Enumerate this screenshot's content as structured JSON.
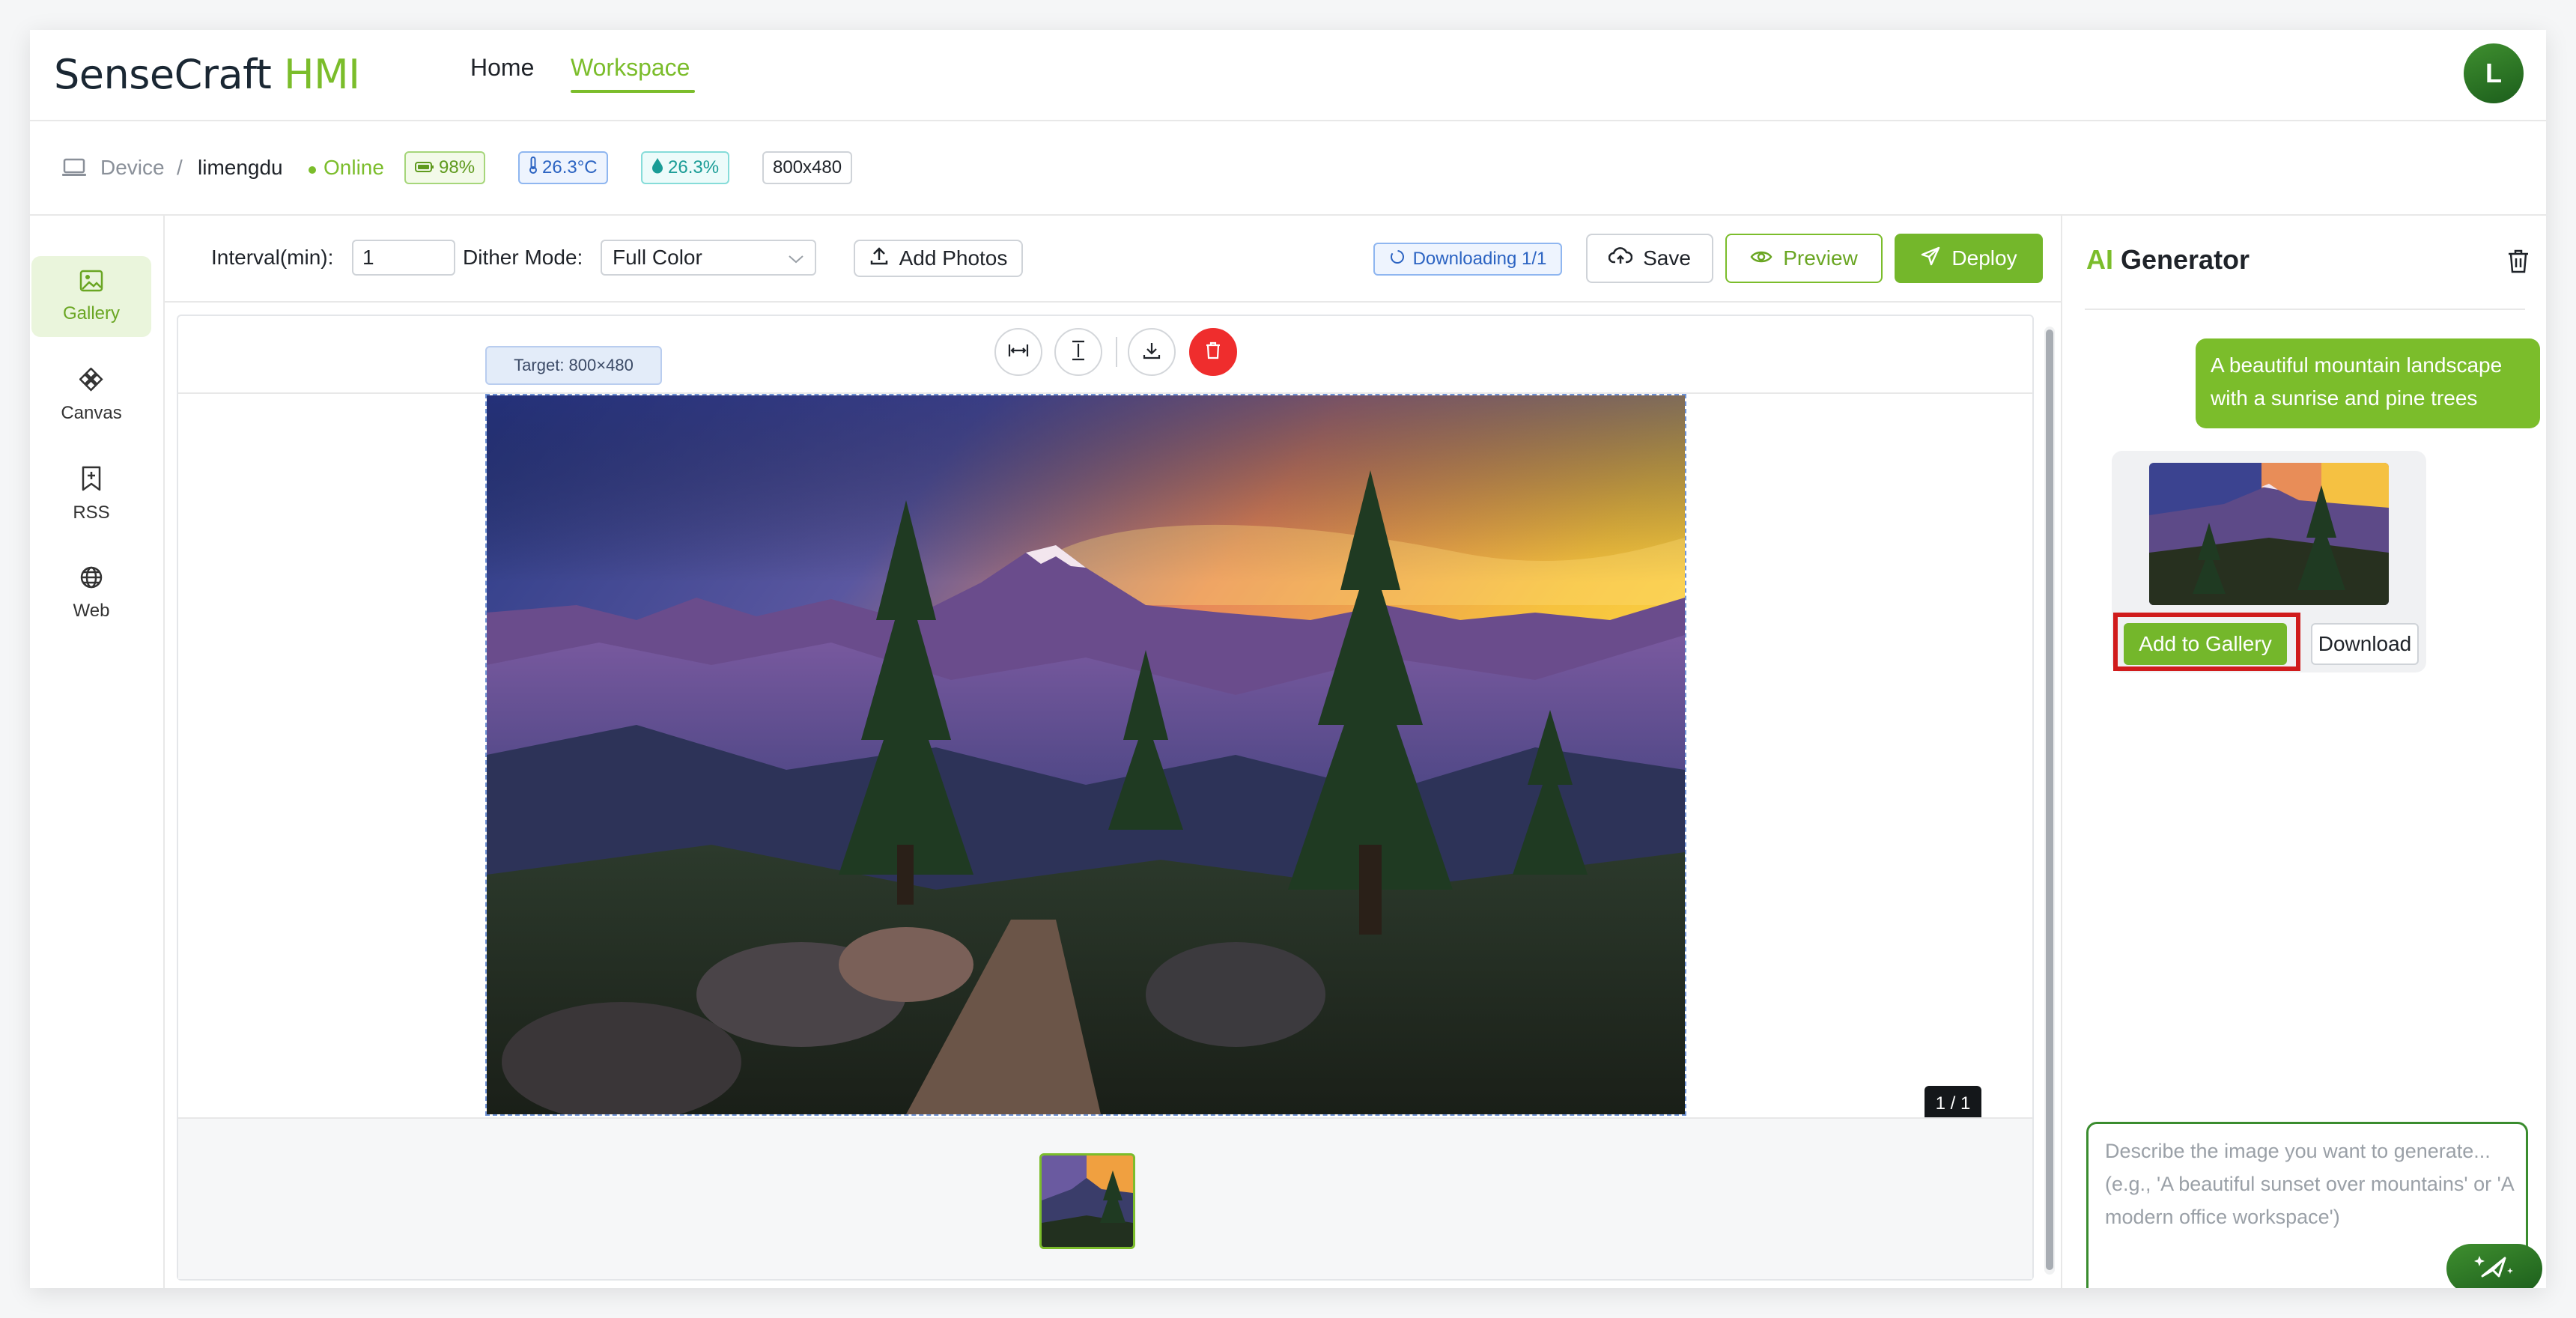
{
  "app": {
    "brand_main": "SenseCraft",
    "brand_accent": " HMI",
    "nav": {
      "home": "Home",
      "workspace": "Workspace"
    },
    "user_initial": "L"
  },
  "device": {
    "breadcrumb_device": "Device",
    "breadcrumb_sep": "/",
    "name": "limengdu",
    "status": "Online",
    "battery": "98%",
    "temperature": "26.3°C",
    "humidity": "26.3%",
    "resolution": "800x480"
  },
  "sidebar": {
    "items": [
      {
        "label": "Gallery",
        "icon": "image-icon",
        "active": true
      },
      {
        "label": "Canvas",
        "icon": "diamond-grid-icon",
        "active": false
      },
      {
        "label": "RSS",
        "icon": "bookmark-plus-icon",
        "active": false
      },
      {
        "label": "Web",
        "icon": "globe-icon",
        "active": false
      }
    ]
  },
  "toolbar": {
    "interval_label": "Interval(min):",
    "interval_value": "1",
    "dither_label": "Dither Mode:",
    "dither_value": "Full Color",
    "add_photos": "Add Photos",
    "download_status": "Downloading 1/1",
    "save": "Save",
    "preview": "Preview",
    "deploy": "Deploy"
  },
  "editor": {
    "target_badge": "Target: 800×480",
    "page_indicator": "1 / 1"
  },
  "ai_panel": {
    "title_accent": "AI",
    "title_rest": " Generator",
    "user_message": "A beautiful mountain landscape with a sunrise and pine trees",
    "add_to_gallery": "Add to Gallery",
    "download": "Download",
    "prompt_placeholder": "Describe the image you want to generate... (e.g., 'A beautiful sunset over mountains' or 'A modern office workspace')"
  },
  "colors": {
    "accent": "#7bbd2b",
    "deploy": "#74b72b",
    "danger": "#ef2d2d",
    "highlight": "#d01c1c"
  }
}
